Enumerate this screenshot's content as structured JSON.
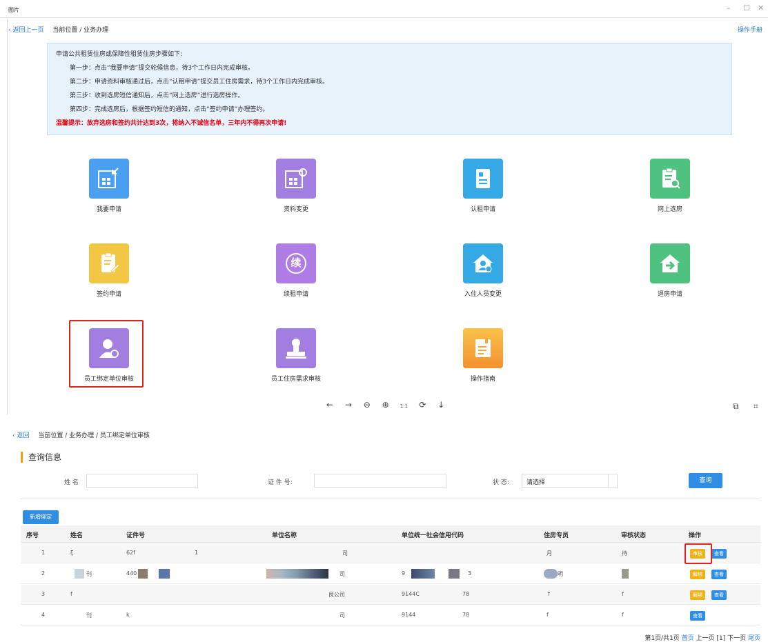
{
  "window": {
    "title": "图片"
  },
  "breadcrumb1": {
    "back": "‹ 返回上一页",
    "path": "当前位置 / 业务办理"
  },
  "manual_link": "操作手册",
  "notice": {
    "heading": "申请公共租赁住房或保障性租赁住房步骤如下:",
    "step1": "第一步：点击“我要申请”提交轮候信息，待3个工作日内完成审核。",
    "step2": "第二步：申请资料审核通过后，点击“认租申请”提交员工住房需求，待3个工作日内完成审核。",
    "step3": "第三步：收到选房短信通知后，点击“网上选房”进行选房操作。",
    "step4": "第四步：完成选房后，根据签约短信的通知，点击“签约申请”办理签约。",
    "warning": "温馨提示：放弃选房和签约共计达到3次，将纳入不诚信名单，三年内不得再次申请!"
  },
  "tiles": [
    {
      "label": "我要申请",
      "icon": "apply-icon",
      "color": "#4a9ff0"
    },
    {
      "label": "资料变更",
      "icon": "data-change-icon",
      "color": "#a27ee0"
    },
    {
      "label": "认租申请",
      "icon": "rent-apply-icon",
      "color": "#35a9e6"
    },
    {
      "label": "网上选房",
      "icon": "online-select-icon",
      "color": "#4ec27e"
    },
    {
      "label": "签约申请",
      "icon": "sign-icon",
      "color": "#f1c744"
    },
    {
      "label": "续租申请",
      "icon": "renew-icon",
      "color": "#b07ce6",
      "glyph": "续"
    },
    {
      "label": "入住人员变更",
      "icon": "resident-change-icon",
      "color": "#35a9e6"
    },
    {
      "label": "退房申请",
      "icon": "checkout-icon",
      "color": "#4ec27e"
    },
    {
      "label": "员工绑定单位审核",
      "icon": "employee-bind-icon",
      "color": "#a27ee0"
    },
    {
      "label": "员工住房需求审核",
      "icon": "housing-demand-icon",
      "color": "#a27ee0"
    },
    {
      "label": "操作指南",
      "icon": "guide-icon",
      "color": "#f6a93b"
    }
  ],
  "viewer_toolbar": [
    "←",
    "→",
    "⊖",
    "⊕",
    "1:1",
    "⟳",
    "↓"
  ],
  "breadcrumb2": {
    "back": "‹ 返回",
    "path": "当前位置 / 业务办理 / 员工绑定单位审核"
  },
  "query": {
    "title": "查询信息",
    "name_label": "姓  名",
    "id_label": "证 件 号:",
    "status_label": "状  态:",
    "status_placeholder": "请选择",
    "search_button": "查询"
  },
  "add_button": "新增绑定",
  "table": {
    "headers": [
      "序号",
      "姓名",
      "证件号",
      "单位名称",
      "单位统一社会信用代码",
      "住房专员",
      "审核状态",
      "操作"
    ],
    "rows": [
      {
        "no": "1",
        "name": "ξ",
        "id": "62f",
        "id2": "1",
        "unit": "司",
        "code": "",
        "code2": "",
        "staff": "月",
        "status": "待",
        "actions": [
          "审核",
          "查看"
        ]
      },
      {
        "no": "2",
        "name": "刊",
        "id": "440",
        "id2": "",
        "unit": "司",
        "code": "9",
        "code2": "3",
        "staff": "明",
        "status": "",
        "actions": [
          "解绑",
          "查看"
        ]
      },
      {
        "no": "3",
        "name": "f",
        "id": "",
        "id2": "",
        "unit": "艮公司",
        "code": "9144C",
        "code2": "78",
        "staff": "↑",
        "status": "f",
        "actions": [
          "解绑",
          "查看"
        ]
      },
      {
        "no": "4",
        "name": "刊",
        "id": "k",
        "id2": "",
        "unit": "司",
        "code": "9144",
        "code2": "78",
        "staff": "f",
        "status": "f",
        "actions": [
          "查看"
        ]
      }
    ]
  },
  "pager": {
    "info": "第1页/共1页",
    "first": "首页",
    "prev": "上一页",
    "current": "[1]",
    "next": "下一页",
    "last": "尾页"
  }
}
